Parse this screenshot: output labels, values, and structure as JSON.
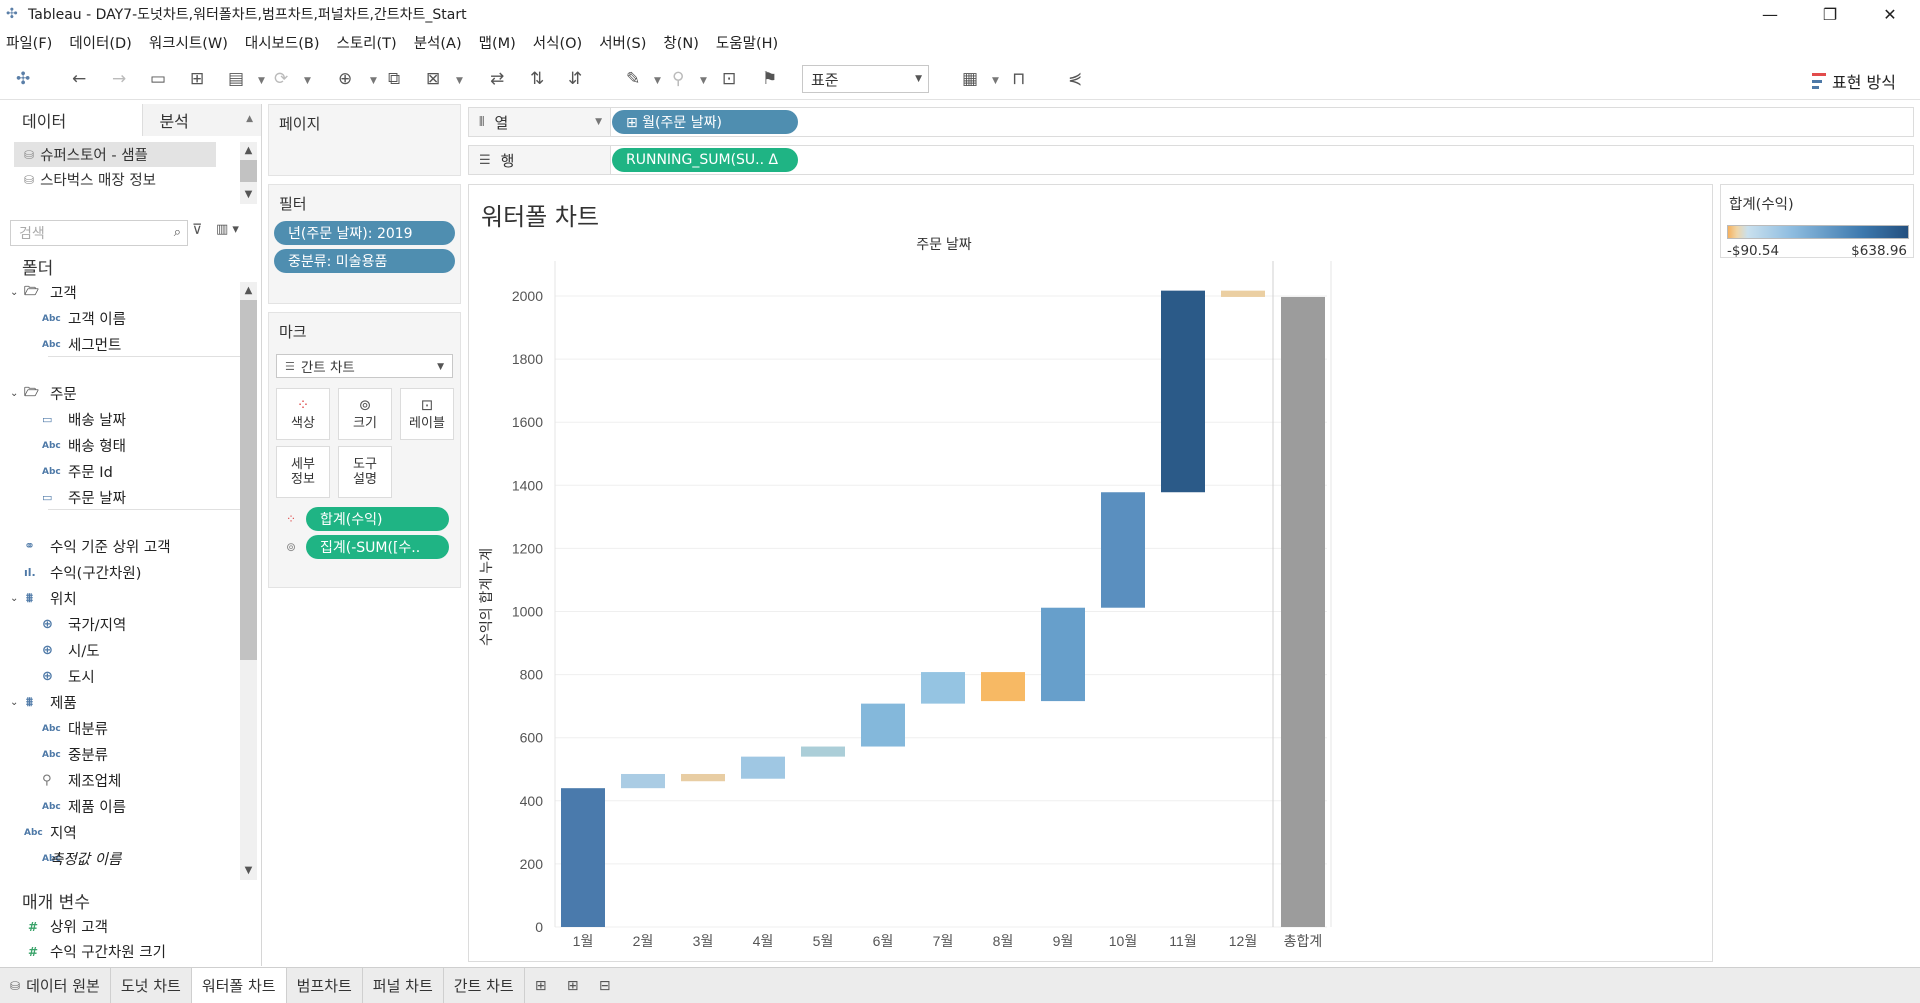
{
  "window": {
    "title": "Tableau - DAY7-도넛차트,워터폴차트,범프차트,퍼널차트,간트차트_Start",
    "minimize": "—",
    "maximize": "❐",
    "close": "✕"
  },
  "menu": [
    "파일(F)",
    "데이터(D)",
    "워크시트(W)",
    "대시보드(B)",
    "스토리(T)",
    "분석(A)",
    "맵(M)",
    "서식(O)",
    "서버(S)",
    "창(N)",
    "도움말(H)"
  ],
  "toolbar": {
    "fit_value": "표준",
    "show_me_label": "표현 방식"
  },
  "data_pane": {
    "tab_data": "데이터",
    "tab_analysis": "분석",
    "datasources": [
      "슈퍼스토어 - 샘플",
      "스타벅스 매장 정보"
    ],
    "search_placeholder": "검색",
    "folders_title": "폴더",
    "fields": [
      {
        "kind": "folder",
        "label": "고객"
      },
      {
        "kind": "dim",
        "type": "Abc",
        "label": "고객 이름"
      },
      {
        "kind": "dim",
        "type": "Abc",
        "label": "세그먼트"
      },
      {
        "kind": "folder",
        "label": "주문"
      },
      {
        "kind": "dim",
        "type": "date",
        "label": "배송 날짜"
      },
      {
        "kind": "dim",
        "type": "Abc",
        "label": "배송 형태"
      },
      {
        "kind": "dim",
        "type": "Abc",
        "label": "주문 Id"
      },
      {
        "kind": "dim",
        "type": "date",
        "label": "주문 날짜"
      },
      {
        "kind": "set",
        "label": "수익 기준 상위 고객"
      },
      {
        "kind": "bin",
        "label": "수익(구간차원)"
      },
      {
        "kind": "hier",
        "label": "위치"
      },
      {
        "kind": "geo",
        "label": "국가/지역"
      },
      {
        "kind": "geo",
        "label": "시/도"
      },
      {
        "kind": "geo",
        "label": "도시"
      },
      {
        "kind": "hier",
        "label": "제품"
      },
      {
        "kind": "dim",
        "type": "Abc",
        "label": "대분류"
      },
      {
        "kind": "dim",
        "type": "Abc",
        "label": "중분류"
      },
      {
        "kind": "clip",
        "label": "제조업체"
      },
      {
        "kind": "dim",
        "type": "Abc",
        "label": "제품 이름"
      },
      {
        "kind": "dim",
        "type": "Abc",
        "label": "지역"
      },
      {
        "kind": "dim",
        "type": "Abc",
        "label": "측정값 이름"
      }
    ],
    "params_title": "매개 변수",
    "params": [
      "상위 고객",
      "수익 구간차원 크기"
    ]
  },
  "cards": {
    "pages_title": "페이지",
    "filters_title": "필터",
    "filters": [
      "년(주문 날짜): 2019",
      "중분류: 미술용품"
    ],
    "marks_title": "마크",
    "marks_type": "간트 차트",
    "mark_buttons": [
      "색상",
      "크기",
      "레이블",
      "세부\n정보",
      "도구\n설명"
    ],
    "mark_pills": [
      "합계(수익)",
      "집계(-SUM([수.."
    ]
  },
  "shelves": {
    "columns_label": "열",
    "columns_pill": "⊞ 월(주문 날짜)",
    "rows_label": "행",
    "rows_pill": "RUNNING_SUM(SU..  Δ"
  },
  "viz": {
    "title": "워터폴 차트"
  },
  "chart_data": {
    "type": "bar",
    "title": "워터폴 차트",
    "xlabel": "주문 날짜",
    "ylabel": "수익의 합계 누계",
    "ylim": [
      0,
      2100
    ],
    "yticks": [
      0,
      200,
      400,
      600,
      800,
      1000,
      1200,
      1400,
      1600,
      1800,
      2000
    ],
    "categories": [
      "1월",
      "2월",
      "3월",
      "4월",
      "5월",
      "6월",
      "7월",
      "8월",
      "9월",
      "10월",
      "11월",
      "12월",
      "총합계"
    ],
    "bars": [
      {
        "start": 0,
        "end": 440,
        "color": "#4a7aac"
      },
      {
        "start": 440,
        "end": 485,
        "color": "#aacce4"
      },
      {
        "start": 462,
        "end": 485,
        "color": "#e8cda3"
      },
      {
        "start": 470,
        "end": 540,
        "color": "#9fc7e3"
      },
      {
        "start": 540,
        "end": 572,
        "color": "#abced8"
      },
      {
        "start": 572,
        "end": 708,
        "color": "#84b8db"
      },
      {
        "start": 708,
        "end": 808,
        "color": "#95c4e2"
      },
      {
        "start": 716,
        "end": 808,
        "color": "#f7b964"
      },
      {
        "start": 716,
        "end": 1012,
        "color": "#679fcb"
      },
      {
        "start": 1012,
        "end": 1378,
        "color": "#5a8fbf"
      },
      {
        "start": 1378,
        "end": 2017,
        "color": "#2b5a88"
      },
      {
        "start": 1997,
        "end": 2017,
        "color": "#ebcfa2"
      },
      {
        "start": 0,
        "end": 1997,
        "color": "#9c9c9c"
      }
    ]
  },
  "legend": {
    "title": "합계(수익)",
    "min": "-$90.54",
    "max": "$638.96"
  },
  "sheet_tabs": {
    "datasource": "데이터 원본",
    "sheets": [
      "도넛 차트",
      "워터폴 차트",
      "범프차트",
      "퍼널 차트",
      "간트 차트"
    ],
    "active": "워터폴 차트"
  }
}
